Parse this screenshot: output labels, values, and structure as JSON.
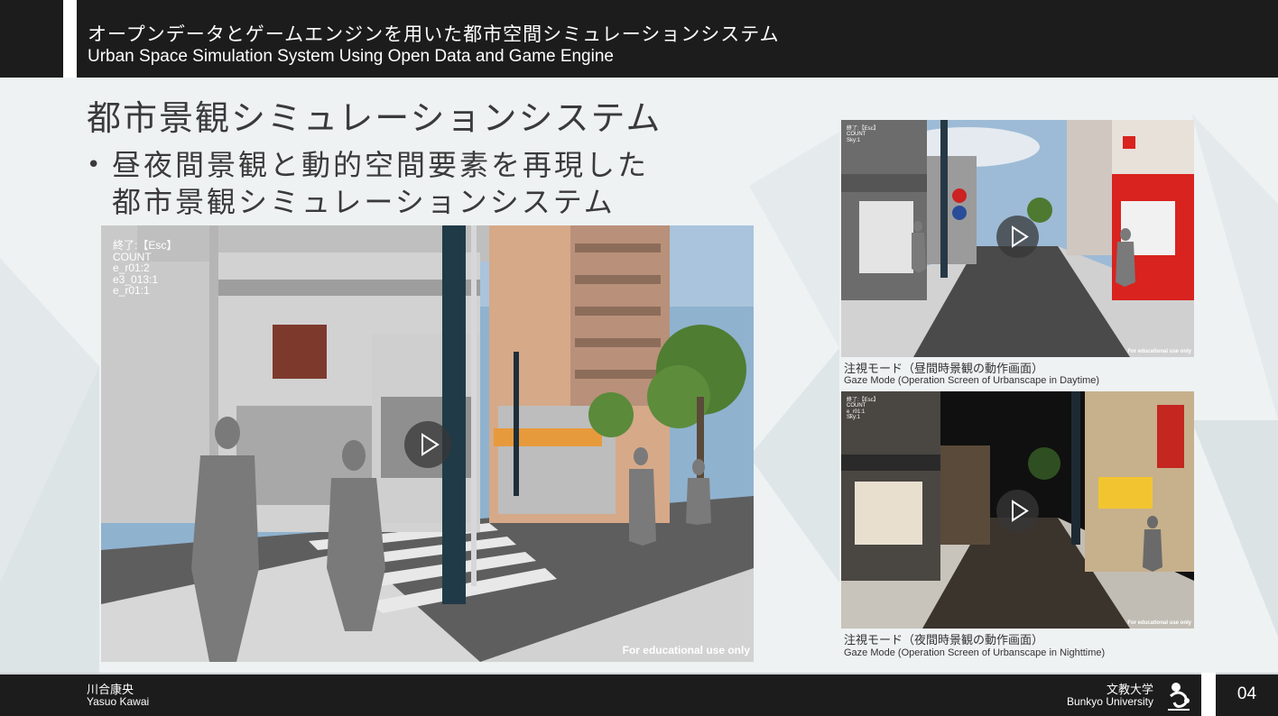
{
  "header": {
    "title_jp": "オープンデータとゲームエンジンを用いた都市空間シミュレーションシステム",
    "title_en": "Urban Space Simulation System Using Open Data and Game Engine"
  },
  "slide": {
    "title": "都市景観シミュレーションシステム",
    "bullet_line1": "昼夜間景観と動的空間要素を再現した",
    "bullet_line2": "都市景観シミュレーションシステム"
  },
  "main_video": {
    "hud": [
      "終了:【Esc】",
      "COUNT",
      "e_r01:2",
      "e3_013:1",
      "e_r01:1"
    ],
    "watermark": "For educational use only"
  },
  "day_video": {
    "hud": [
      "終了:【Esc】",
      "COUNT",
      "Sky:1"
    ],
    "watermark": "For educational use only",
    "caption_jp": "注視モード（昼間時景観の動作画面）",
    "caption_en": "Gaze Mode (Operation Screen of Urbanscape in Daytime)"
  },
  "night_video": {
    "hud": [
      "終了:【Esc】",
      "COUNT",
      "e_r01:1",
      "Sky:1"
    ],
    "watermark": "For educational use only",
    "caption_jp": "注視モード（夜間時景観の動作画面）",
    "caption_en": "Gaze Mode (Operation Screen of Urbanscape in Nighttime)"
  },
  "footer": {
    "author_jp": "川合康央",
    "author_en": "Yasuo Kawai",
    "university_jp": "文教大学",
    "university_en": "Bunkyo University",
    "page_number": "04"
  },
  "colors": {
    "bar_bg": "#1c1c1c",
    "slide_bg": "#eef2f3",
    "text": "#3a3a3a"
  }
}
